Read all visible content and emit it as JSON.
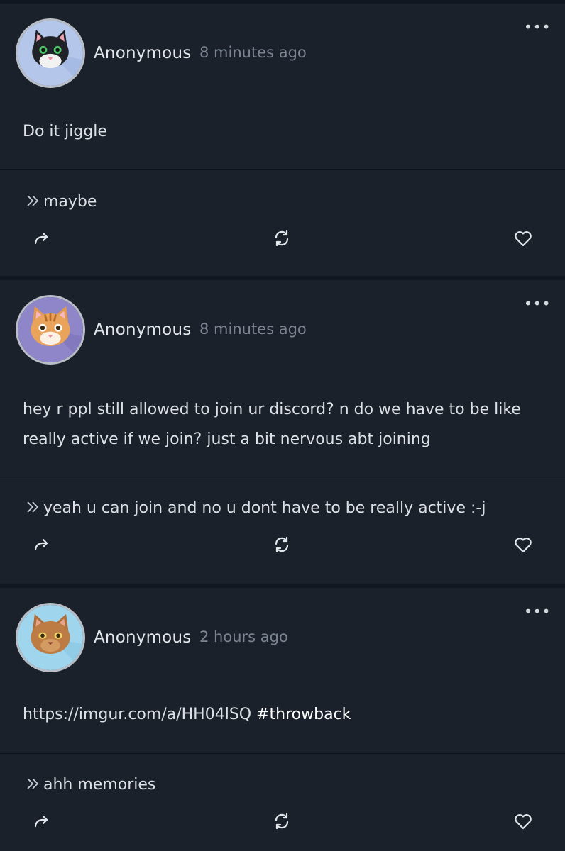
{
  "posts": [
    {
      "author": "Anonymous",
      "time": "8 minutes ago",
      "avatar": {
        "icon": "black-cat-icon",
        "bg": "#b4c7ea"
      },
      "question": "Do it jiggle",
      "hashtag": "",
      "answer": "maybe"
    },
    {
      "author": "Anonymous",
      "time": "8 minutes ago",
      "avatar": {
        "icon": "orange-tabby-cat-icon",
        "bg": "#8f86c9"
      },
      "question": "hey r ppl still allowed to join ur discord? n do we have to be like really active if we join? just a bit nervous abt joining",
      "hashtag": "",
      "answer": "yeah u can join and no u dont have to be really active :-j"
    },
    {
      "author": "Anonymous",
      "time": "2 hours ago",
      "avatar": {
        "icon": "brown-cat-icon",
        "bg": "#9fd6ee"
      },
      "question": "https://imgur.com/a/HH04lSQ",
      "hashtag": "#throwback",
      "answer": "ahh memories"
    }
  ],
  "icons": {
    "more": "more-options-icon",
    "share": "share-icon",
    "reask": "reask-icon",
    "like": "heart-icon"
  },
  "colors": {
    "background": "#111620",
    "card": "#1a212b",
    "text": "#dde1e6",
    "muted": "#7b8592"
  }
}
